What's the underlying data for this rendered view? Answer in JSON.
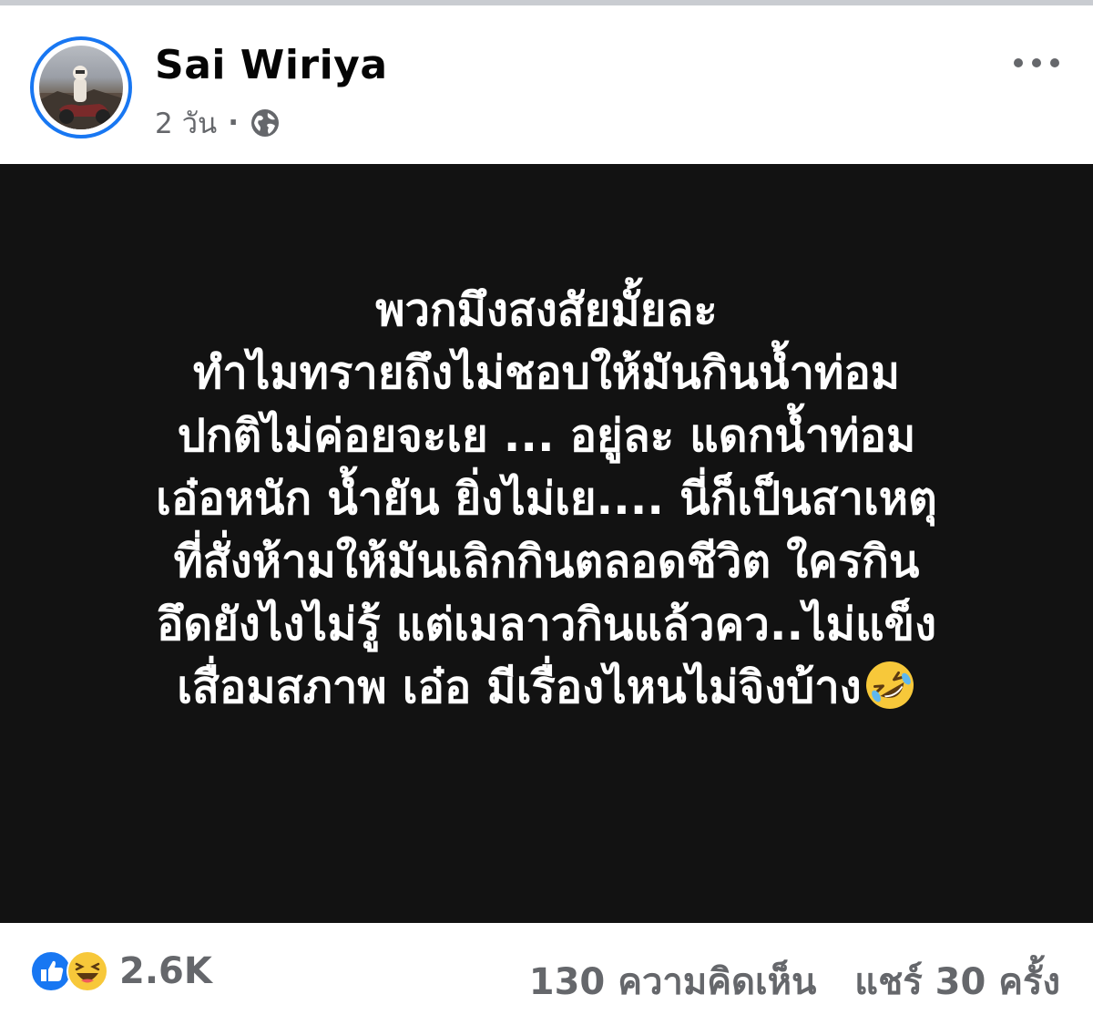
{
  "post": {
    "author": "Sai Wiriya",
    "time": "2 วัน",
    "separator": "·",
    "audience_icon": "globe-icon",
    "menu_icon": "more-options-icon",
    "lines": [
      "พวกมึงสงสัยมั้ยละ",
      "ทำไมทรายถึงไม่ชอบให้มันกินน้ำท่อม",
      "ปกติไม่ค่อยจะเย ... อยู่ละ แดกน้ำท่อม",
      "เอ๋อหนัก น้ำยัน ยิ่งไม่เย.... นี่ก็เป็นสาเหตุ",
      "ที่สั่งห้ามให้มันเลิกกินตลอดชีวิต ใครกิน",
      "อึดยังไงไม่รู้ แต่เมลาวกินแล้วคว..ไม่แข็ง",
      "เสื่อมสภาพ เอ๋อ  มีเรื่องไหนไม่จิงบ้าง"
    ],
    "trailing_emoji": "rofl-emoji",
    "background_color": "#121212",
    "text_color": "#ffffff"
  },
  "footer": {
    "reaction_icons": [
      "like-icon",
      "haha-icon"
    ],
    "reaction_count": "2.6K",
    "comments": "130 ความคิดเห็น",
    "shares": "แชร์ 30 ครั้ง"
  },
  "colors": {
    "accent": "#1877f2",
    "secondary_text": "#65676b"
  }
}
